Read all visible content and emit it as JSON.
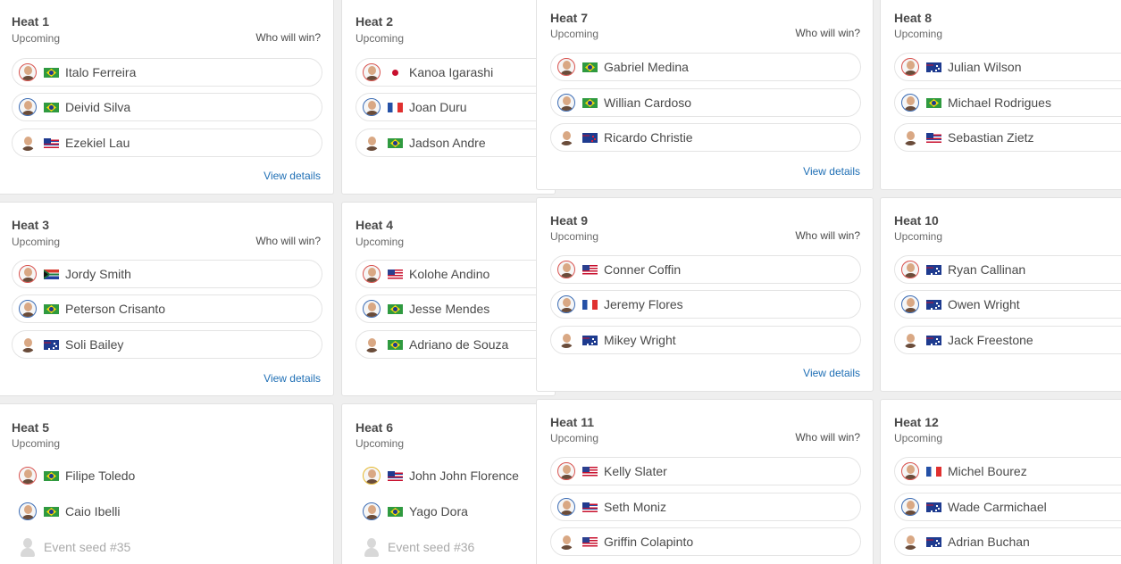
{
  "labels": {
    "upcoming": "Upcoming",
    "who_will_win": "Who will win?",
    "view_details": "View details"
  },
  "colors": {
    "link": "#1f6fb5",
    "card_border": "#e2e2e2",
    "background": "#efefef"
  },
  "heats": [
    {
      "title": "Heat 1",
      "status": "Upcoming",
      "prompt": "Who will win?",
      "link": "View details",
      "surfers": [
        {
          "name": "Italo Ferreira",
          "flag": "brazil-flag"
        },
        {
          "name": "Deivid Silva",
          "flag": "brazil-flag"
        },
        {
          "name": "Ezekiel Lau",
          "flag": "hawaii-flag"
        }
      ]
    },
    {
      "title": "Heat 2",
      "status": "Upcoming",
      "surfers": [
        {
          "name": "Kanoa Igarashi",
          "flag": "japan-flag"
        },
        {
          "name": "Joan Duru",
          "flag": "france-flag"
        },
        {
          "name": "Jadson Andre",
          "flag": "brazil-flag"
        }
      ]
    },
    {
      "title": "Heat 3",
      "status": "Upcoming",
      "prompt": "Who will win?",
      "link": "View details",
      "surfers": [
        {
          "name": "Jordy Smith",
          "flag": "south-africa-flag"
        },
        {
          "name": "Peterson Crisanto",
          "flag": "brazil-flag"
        },
        {
          "name": "Soli Bailey",
          "flag": "australia-flag"
        }
      ]
    },
    {
      "title": "Heat 4",
      "status": "Upcoming",
      "surfers": [
        {
          "name": "Kolohe Andino",
          "flag": "usa-flag"
        },
        {
          "name": "Jesse Mendes",
          "flag": "brazil-flag"
        },
        {
          "name": "Adriano de Souza",
          "flag": "brazil-flag"
        }
      ]
    },
    {
      "title": "Heat 5",
      "status": "Upcoming",
      "surfers": [
        {
          "name": "Filipe Toledo",
          "flag": "brazil-flag"
        },
        {
          "name": "Caio Ibelli",
          "flag": "brazil-flag"
        },
        {
          "name": "Event seed #35",
          "flag": ""
        }
      ]
    },
    {
      "title": "Heat 6",
      "status": "Upcoming",
      "surfers": [
        {
          "name": "John John Florence",
          "flag": "hawaii-flag"
        },
        {
          "name": "Yago Dora",
          "flag": "brazil-flag"
        },
        {
          "name": "Event seed #36",
          "flag": ""
        }
      ]
    },
    {
      "title": "Heat 7",
      "status": "Upcoming",
      "prompt": "Who will win?",
      "link": "View details",
      "surfers": [
        {
          "name": "Gabriel Medina",
          "flag": "brazil-flag"
        },
        {
          "name": "Willian Cardoso",
          "flag": "brazil-flag"
        },
        {
          "name": "Ricardo Christie",
          "flag": "new-zealand-flag"
        }
      ]
    },
    {
      "title": "Heat 8",
      "status": "Upcoming",
      "surfers": [
        {
          "name": "Julian Wilson",
          "flag": "australia-flag"
        },
        {
          "name": "Michael Rodrigues",
          "flag": "brazil-flag"
        },
        {
          "name": "Sebastian Zietz",
          "flag": "hawaii-flag"
        }
      ]
    },
    {
      "title": "Heat 9",
      "status": "Upcoming",
      "prompt": "Who will win?",
      "link": "View details",
      "surfers": [
        {
          "name": "Conner Coffin",
          "flag": "usa-flag"
        },
        {
          "name": "Jeremy Flores",
          "flag": "france-flag"
        },
        {
          "name": "Mikey Wright",
          "flag": "australia-flag"
        }
      ]
    },
    {
      "title": "Heat 10",
      "status": "Upcoming",
      "surfers": [
        {
          "name": "Ryan Callinan",
          "flag": "australia-flag"
        },
        {
          "name": "Owen Wright",
          "flag": "australia-flag"
        },
        {
          "name": "Jack Freestone",
          "flag": "australia-flag"
        }
      ]
    },
    {
      "title": "Heat 11",
      "status": "Upcoming",
      "prompt": "Who will win?",
      "surfers": [
        {
          "name": "Kelly Slater",
          "flag": "usa-flag"
        },
        {
          "name": "Seth Moniz",
          "flag": "hawaii-flag"
        },
        {
          "name": "Griffin Colapinto",
          "flag": "usa-flag"
        }
      ]
    },
    {
      "title": "Heat 12",
      "status": "Upcoming",
      "surfers": [
        {
          "name": "Michel Bourez",
          "flag": "france-flag"
        },
        {
          "name": "Wade Carmichael",
          "flag": "australia-flag"
        },
        {
          "name": "Adrian Buchan",
          "flag": "australia-flag"
        }
      ]
    }
  ]
}
